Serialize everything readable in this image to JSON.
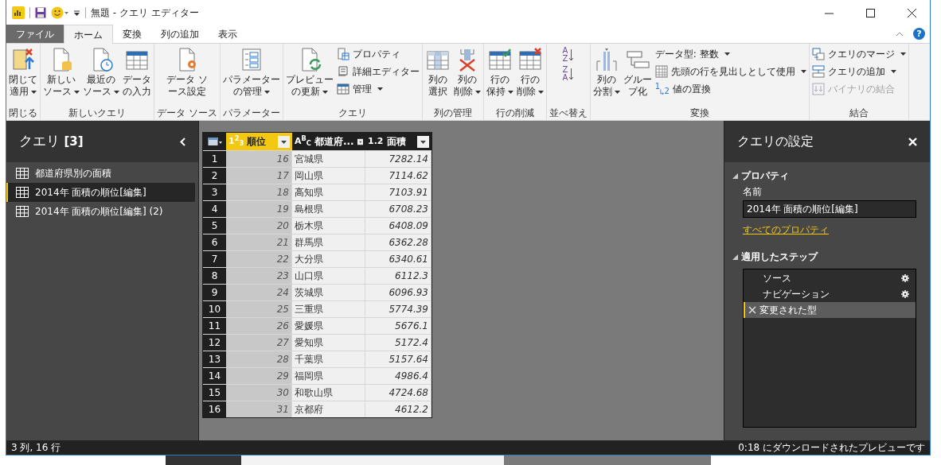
{
  "title_bar": {
    "title": "無題 - クエリ エディター"
  },
  "tabs": [
    {
      "label": "ファイル",
      "kind": "file",
      "selected": false
    },
    {
      "label": "ホーム",
      "kind": "tab",
      "selected": true
    },
    {
      "label": "変換",
      "kind": "tab",
      "selected": false
    },
    {
      "label": "列の追加",
      "kind": "tab",
      "selected": false
    },
    {
      "label": "表示",
      "kind": "tab",
      "selected": false
    }
  ],
  "help": "?",
  "ribbon": {
    "groups": [
      {
        "label": "閉じる",
        "items": [
          {
            "kind": "large",
            "lines": [
              "閉じて",
              "適用"
            ],
            "dropdown": true
          }
        ]
      },
      {
        "label": "新しいクエリ",
        "items": [
          {
            "kind": "large",
            "lines": [
              "新しい",
              "ソース"
            ],
            "dropdown": true
          },
          {
            "kind": "large",
            "lines": [
              "最近の",
              "ソース"
            ],
            "dropdown": true
          },
          {
            "kind": "large",
            "lines": [
              "データ",
              "の入力"
            ],
            "dropdown": false
          }
        ]
      },
      {
        "label": "データ ソース",
        "items": [
          {
            "kind": "large",
            "lines": [
              "データ ソ",
              "ース設定"
            ],
            "dropdown": false
          }
        ]
      },
      {
        "label": "パラメーター",
        "items": [
          {
            "kind": "large",
            "lines": [
              "パラメーター",
              "の管理"
            ],
            "dropdown": true
          }
        ]
      },
      {
        "label": "クエリ",
        "items": [
          {
            "kind": "large",
            "lines": [
              "プレビュー",
              "の更新"
            ],
            "dropdown": true
          },
          {
            "kind": "stack",
            "entries": [
              {
                "label": "プロパティ",
                "dropdown": false,
                "disabled": false
              },
              {
                "label": "詳細エディター",
                "dropdown": false,
                "disabled": false
              },
              {
                "label": "管理",
                "dropdown": true,
                "disabled": false
              }
            ]
          }
        ]
      },
      {
        "label": "列の管理",
        "items": [
          {
            "kind": "large",
            "lines": [
              "列の",
              "選択"
            ],
            "dropdown": false
          },
          {
            "kind": "large",
            "lines": [
              "列の",
              "削除"
            ],
            "dropdown": true
          }
        ]
      },
      {
        "label": "行の削減",
        "items": [
          {
            "kind": "large",
            "lines": [
              "行の",
              "保持"
            ],
            "dropdown": true
          },
          {
            "kind": "large",
            "lines": [
              "行の",
              "削除"
            ],
            "dropdown": true
          }
        ]
      },
      {
        "label": "並べ替え",
        "items": [
          {
            "kind": "sort",
            "entries": [
              {
                "letters": [
                  "A",
                  "Z"
                ]
              },
              {
                "letters": [
                  "Z",
                  "A"
                ]
              }
            ]
          }
        ]
      },
      {
        "label": "変換",
        "items": [
          {
            "kind": "large",
            "lines": [
              "列の",
              "分割"
            ],
            "dropdown": true
          },
          {
            "kind": "large",
            "lines": [
              "グルー",
              "プ化"
            ],
            "dropdown": false
          },
          {
            "kind": "stack",
            "entries": [
              {
                "label": "データ型: 整数",
                "dropdown": true,
                "disabled": false
              },
              {
                "label": "先頭の行を見出しとして使用",
                "dropdown": true,
                "disabled": false
              },
              {
                "label": "値の置換",
                "glyphs": [
                  "1",
                  "2"
                ],
                "dropdown": false,
                "disabled": false
              }
            ]
          }
        ]
      },
      {
        "label": "結合",
        "items": [
          {
            "kind": "stack",
            "entries": [
              {
                "label": "クエリのマージ",
                "dropdown": true,
                "disabled": false
              },
              {
                "label": "クエリの追加",
                "dropdown": true,
                "disabled": false
              },
              {
                "label": "バイナリの結合",
                "dropdown": false,
                "disabled": true
              }
            ]
          }
        ]
      }
    ]
  },
  "queries": {
    "title": "クエリ",
    "count": "[3]",
    "items": [
      {
        "label": "都道府県別の面積",
        "selected": false
      },
      {
        "label": "2014年 面積の順位[編集]",
        "selected": true
      },
      {
        "label": "2014年 面積の順位[編集] (2)",
        "selected": false
      }
    ]
  },
  "table": {
    "columns": [
      {
        "type": "1$^{2}$$_{3}$",
        "name": "順位",
        "selected": true
      },
      {
        "type": "A$^{B}$$_{C}$",
        "name": "都道府...",
        "selected": false
      },
      {
        "type": "1.2",
        "name": "面積",
        "selected": false
      }
    ],
    "rows": [
      {
        "index": "1",
        "cells": [
          "16",
          "宮城県",
          "7282.14"
        ]
      },
      {
        "index": "2",
        "cells": [
          "17",
          "岡山県",
          "7114.62"
        ]
      },
      {
        "index": "3",
        "cells": [
          "18",
          "高知県",
          "7103.91"
        ]
      },
      {
        "index": "4",
        "cells": [
          "19",
          "島根県",
          "6708.23"
        ]
      },
      {
        "index": "5",
        "cells": [
          "20",
          "栃木県",
          "6408.09"
        ]
      },
      {
        "index": "6",
        "cells": [
          "21",
          "群馬県",
          "6362.28"
        ]
      },
      {
        "index": "7",
        "cells": [
          "22",
          "大分県",
          "6340.61"
        ]
      },
      {
        "index": "8",
        "cells": [
          "23",
          "山口県",
          "6112.3"
        ]
      },
      {
        "index": "9",
        "cells": [
          "24",
          "茨城県",
          "6096.93"
        ]
      },
      {
        "index": "10",
        "cells": [
          "25",
          "三重県",
          "5774.39"
        ]
      },
      {
        "index": "11",
        "cells": [
          "26",
          "愛媛県",
          "5676.1"
        ]
      },
      {
        "index": "12",
        "cells": [
          "27",
          "愛知県",
          "5172.4"
        ]
      },
      {
        "index": "13",
        "cells": [
          "28",
          "千葉県",
          "5157.64"
        ]
      },
      {
        "index": "14",
        "cells": [
          "29",
          "福岡県",
          "4986.4"
        ]
      },
      {
        "index": "15",
        "cells": [
          "30",
          "和歌山県",
          "4724.68"
        ]
      },
      {
        "index": "16",
        "cells": [
          "31",
          "京都府",
          "4612.2"
        ]
      }
    ]
  },
  "settings": {
    "title": "クエリの設定",
    "properties": {
      "heading": "プロパティ",
      "name_label": "名前",
      "name_value": "2014年 面積の順位[編集]",
      "link": "すべてのプロパティ"
    },
    "steps_heading": "適用したステップ",
    "steps": [
      {
        "label": "ソース",
        "has_settings": true,
        "selected": false
      },
      {
        "label": "ナビゲーション",
        "has_settings": true,
        "selected": false
      },
      {
        "label": "変更された型",
        "has_settings": false,
        "selected": true
      }
    ]
  },
  "status_bar": {
    "left": "3 列, 16 行",
    "right": "0:18 にダウンロードされたプレビューです"
  }
}
